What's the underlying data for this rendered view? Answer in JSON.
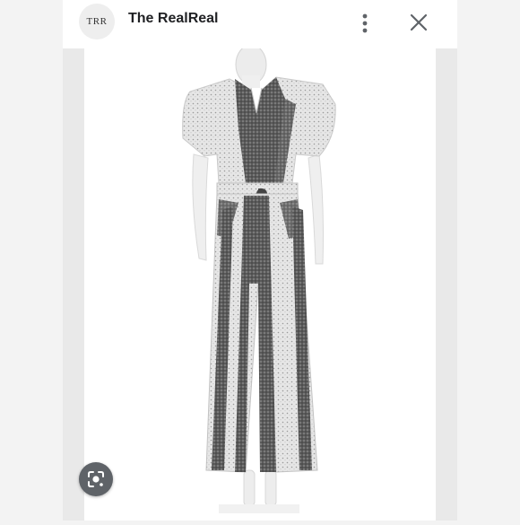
{
  "header": {
    "logo_text": "TRR",
    "site_name": "The RealReal"
  },
  "icons": {
    "more": "more-vert-icon",
    "close": "close-icon",
    "lens": "google-lens-icon"
  },
  "colors": {
    "lens_button": "#5f6368",
    "header_text": "#202124"
  }
}
